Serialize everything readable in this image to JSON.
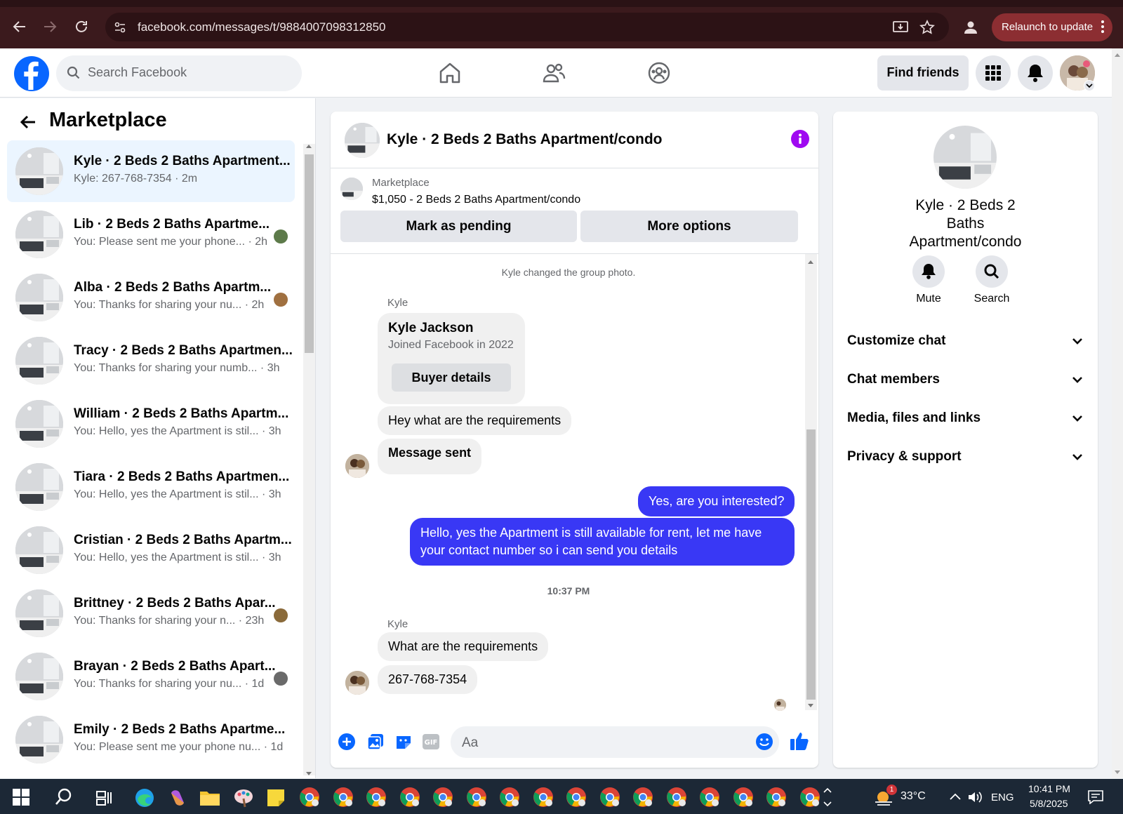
{
  "browser": {
    "url": "facebook.com/messages/t/9884007098312850",
    "relaunch_label": "Relaunch to update",
    "colors": {
      "frame": "#3b1a1d",
      "url_bar": "#2c1215",
      "relaunch": "#8c2e32"
    }
  },
  "header": {
    "search_placeholder": "Search Facebook",
    "find_friends": "Find friends",
    "brand_color": "#0866ff"
  },
  "sidebar": {
    "title": "Marketplace",
    "conversations": [
      {
        "title": "Kyle · 2 Beds 2 Baths Apartment...",
        "preview": "Kyle: 267-768-7354 · 2m",
        "active": true
      },
      {
        "title": "Lib · 2 Beds 2 Baths Apartme...",
        "preview": "You: Please sent me your phone... · 2h"
      },
      {
        "title": "Alba · 2 Beds 2 Baths Apartm...",
        "preview": "You: Thanks for sharing your nu... · 2h"
      },
      {
        "title": "Tracy · 2 Beds 2 Baths Apartmen...",
        "preview": "You: Thanks for sharing your numb... · 3h"
      },
      {
        "title": "William · 2 Beds 2 Baths Apartm...",
        "preview": "You: Hello, yes the Apartment is stil... · 3h"
      },
      {
        "title": "Tiara · 2 Beds 2 Baths Apartmen...",
        "preview": "You: Hello, yes the Apartment is stil... · 3h"
      },
      {
        "title": "Cristian · 2 Beds 2 Baths Apartm...",
        "preview": "You: Hello, yes the Apartment is stil... · 3h"
      },
      {
        "title": "Brittney · 2 Beds 2 Baths Apar...",
        "preview": "You: Thanks for sharing your n... · 23h"
      },
      {
        "title": "Brayan · 2 Beds 2 Baths Apart...",
        "preview": "You: Thanks for sharing your nu... · 1d"
      },
      {
        "title": "Emily · 2 Beds 2 Baths Apartme...",
        "preview": "You: Please sent me your phone nu... · 1d"
      }
    ]
  },
  "chat": {
    "title": "Kyle · 2 Beds 2 Baths Apartment/condo",
    "listing_label": "Marketplace",
    "listing_price": "$1,050 - 2 Beds 2 Baths Apartment/condo",
    "mark_pending": "Mark as pending",
    "more_options": "More options",
    "system_message": "Kyle changed the group photo.",
    "sender1": "Kyle",
    "buyer_name": "Kyle Jackson",
    "buyer_joined": "Joined Facebook in 2022",
    "buyer_details": "Buyer details",
    "msg1": "Hey what are the requirements",
    "msg2": "Message sent",
    "mine1": "Yes, are you interested?",
    "mine2": "Hello, yes the Apartment is still available for rent, let me have your contact number so i can send you details",
    "time": "10:37 PM",
    "sender2": "Kyle",
    "msg3": "What are the requirements",
    "msg4": "267-768-7354",
    "input_placeholder": "Aa",
    "accent": "#3938f5"
  },
  "right_panel": {
    "title": "Kyle · 2 Beds 2 Baths Apartment/condo",
    "mute": "Mute",
    "search": "Search",
    "sections": [
      "Customize chat",
      "Chat members",
      "Media, files and links",
      "Privacy & support"
    ]
  },
  "taskbar": {
    "temperature": "33°C",
    "language": "ENG",
    "time": "10:41 PM",
    "date": "5/8/2025",
    "weather_badge": "1"
  }
}
